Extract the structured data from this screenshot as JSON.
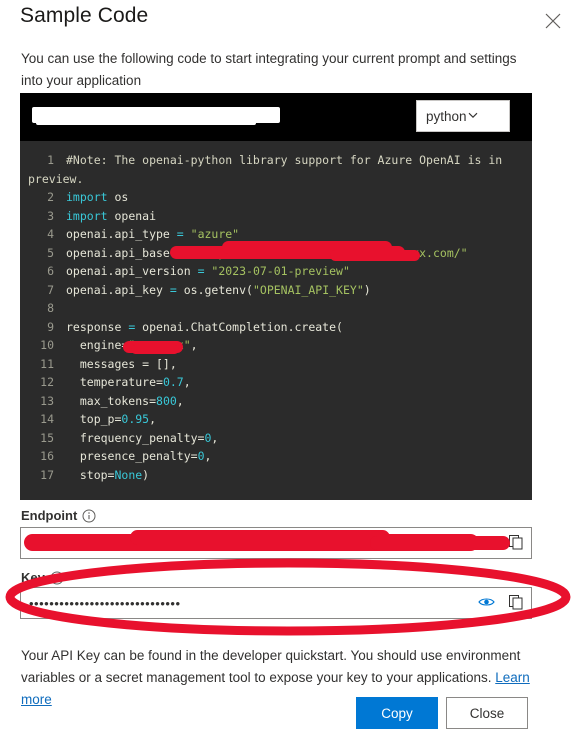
{
  "dialog": {
    "title": "Sample Code",
    "close_icon": "close-icon",
    "intro": "You can use the following code to start integrating your current prompt and settings into your application"
  },
  "code_block": {
    "header_text_redacted": true,
    "language_selected": "python",
    "language_chevron": "chevron-down-icon",
    "background_color": "#2b2b2b",
    "header_background_color": "#000000",
    "lines": [
      {
        "number": "1",
        "text": "#Note: The openai-python library support for Azure OpenAI is in"
      },
      {
        "number": "",
        "text": "preview."
      },
      {
        "number": "2",
        "text": "import os"
      },
      {
        "number": "3",
        "text": "import openai"
      },
      {
        "number": "4",
        "text": "openai.api_type = \"azure\""
      },
      {
        "number": "5",
        "text": "openai.api_base = \"https://[REDACTED].com/\""
      },
      {
        "number": "6",
        "text": "openai.api_version = \"2023-07-01-preview\""
      },
      {
        "number": "7",
        "text": "openai.api_key = os.getenv(\"OPENAI_API_KEY\")"
      },
      {
        "number": "8",
        "text": ""
      },
      {
        "number": "9",
        "text": "response = openai.ChatCompletion.create("
      },
      {
        "number": "10",
        "text": "  engine=\"[REDACTED]\","
      },
      {
        "number": "11",
        "text": "  messages = [],"
      },
      {
        "number": "12",
        "text": "  temperature=0.7,"
      },
      {
        "number": "13",
        "text": "  max_tokens=800,"
      },
      {
        "number": "14",
        "text": "  top_p=0.95,"
      },
      {
        "number": "15",
        "text": "  frequency_penalty=0,"
      },
      {
        "number": "16",
        "text": "  presence_penalty=0,"
      },
      {
        "number": "17",
        "text": "  stop=None)"
      }
    ]
  },
  "endpoint": {
    "label": "Endpoint",
    "info_icon": "info-icon",
    "value": "",
    "redacted": true,
    "copy_icon": "copy-icon"
  },
  "key": {
    "label": "Key",
    "info_icon": "info-icon",
    "value": "••••••••••••••••••••••••••••••",
    "reveal_icon": "eye-icon",
    "copy_icon": "copy-icon",
    "reveal_icon_color": "#0078d4"
  },
  "helper": {
    "text": "Your API Key can be found in the developer quickstart. You should use environment variables or a secret management tool to expose your key to your applications. ",
    "link_label": "Learn more"
  },
  "footer": {
    "primary_label": "Copy",
    "secondary_label": "Close",
    "primary_color": "#0078d4"
  },
  "annotation": {
    "shape": "ellipse",
    "color": "#e8112d",
    "target": "key-field"
  }
}
